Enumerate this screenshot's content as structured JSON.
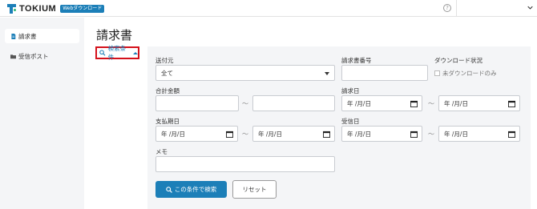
{
  "header": {
    "brand": "TOKIUM",
    "badge": "Webダウンロード",
    "help_glyph": "?"
  },
  "sidebar": {
    "items": [
      {
        "label": "請求書",
        "icon": "document-icon",
        "active": true
      },
      {
        "label": "受信ポスト",
        "icon": "folder-icon",
        "active": false
      }
    ]
  },
  "main": {
    "title": "請求書",
    "search_toggle_label": "検索条件"
  },
  "search_form": {
    "sender": {
      "label": "送付元",
      "value": "全て"
    },
    "invoice_number": {
      "label": "請求書番号",
      "value": ""
    },
    "download_status": {
      "label": "ダウンロード状況",
      "checkbox_label": "未ダウンロードのみ",
      "checked": false
    },
    "total_amount": {
      "label": "合計金額",
      "from": "",
      "to": ""
    },
    "invoice_date": {
      "label": "請求日",
      "from": "年 /月/日",
      "to": "年 /月/日"
    },
    "payment_due": {
      "label": "支払期日",
      "from": "年 /月/日",
      "to": "年 /月/日"
    },
    "received_date": {
      "label": "受信日",
      "from": "年 /月/日",
      "to": "年 /月/日"
    },
    "memo": {
      "label": "メモ",
      "value": ""
    },
    "range_separator": "〜",
    "search_button": "この条件で検索",
    "reset_button": "リセット"
  },
  "colors": {
    "brand": "#1c7fb8",
    "highlight_border": "#d4111b",
    "panel_bg": "#f4f5f7"
  }
}
